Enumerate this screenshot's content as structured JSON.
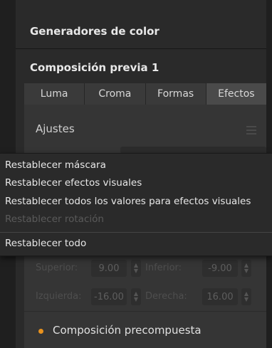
{
  "sections": {
    "color_generators": "Generadores de color",
    "preview_comp": "Composición previa 1"
  },
  "tabs": [
    "Luma",
    "Croma",
    "Formas",
    "Efectos"
  ],
  "active_tab": "Efectos",
  "settings": {
    "title": "Ajustes",
    "fields": {
      "top_label": "Superior:",
      "top_value": "9.00",
      "bottom_label": "Inferior:",
      "bottom_value": "-9.00",
      "left_label": "Izquierda:",
      "left_value": "-16.00",
      "right_label": "Derecha:",
      "right_value": "16.00"
    }
  },
  "radio": {
    "label": "Composición precompuesta",
    "selected": true,
    "color": "#e8921e"
  },
  "context_menu": {
    "items": [
      {
        "label": "Restablecer máscara",
        "enabled": true
      },
      {
        "label": "Restablecer efectos visuales",
        "enabled": true
      },
      {
        "label": "Restablecer todos los valores para efectos visuales",
        "enabled": true
      },
      {
        "label": "Restablecer rotación",
        "enabled": false
      },
      {
        "label": "Restablecer todo",
        "enabled": true
      }
    ]
  }
}
